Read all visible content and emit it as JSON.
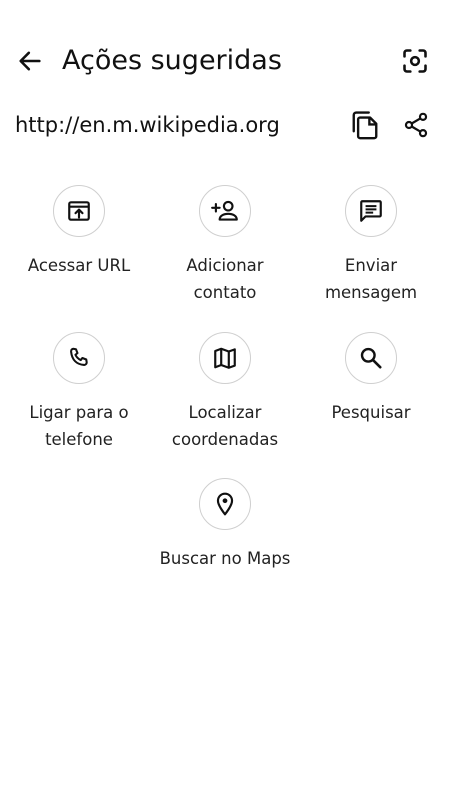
{
  "header": {
    "title": "Ações sugeridas",
    "back_icon": "arrow-back-icon",
    "scan_icon": "screenshot-scan-icon"
  },
  "url_row": {
    "url": "http://en.m.wikipedia.org",
    "copy_icon": "copy-icon",
    "share_icon": "share-icon"
  },
  "actions": [
    {
      "label_lines": [
        "Acessar URL"
      ],
      "icon": "open-in-browser-icon"
    },
    {
      "label_lines": [
        "Adicionar",
        "contato"
      ],
      "icon": "person-add-icon"
    },
    {
      "label_lines": [
        "Enviar",
        "mensagem"
      ],
      "icon": "message-icon"
    },
    {
      "label_lines": [
        "Ligar para o",
        "telefone"
      ],
      "icon": "phone-icon"
    },
    {
      "label_lines": [
        "Localizar",
        "coordenadas"
      ],
      "icon": "map-icon"
    },
    {
      "label_lines": [
        "Pesquisar"
      ],
      "icon": "search-icon"
    },
    {
      "label_lines": [
        "Buscar no Maps"
      ],
      "icon": "location-pin-icon"
    }
  ],
  "colors": {
    "background": "#ffffff",
    "text": "#111111",
    "circle_border": "#cfcfcf"
  }
}
